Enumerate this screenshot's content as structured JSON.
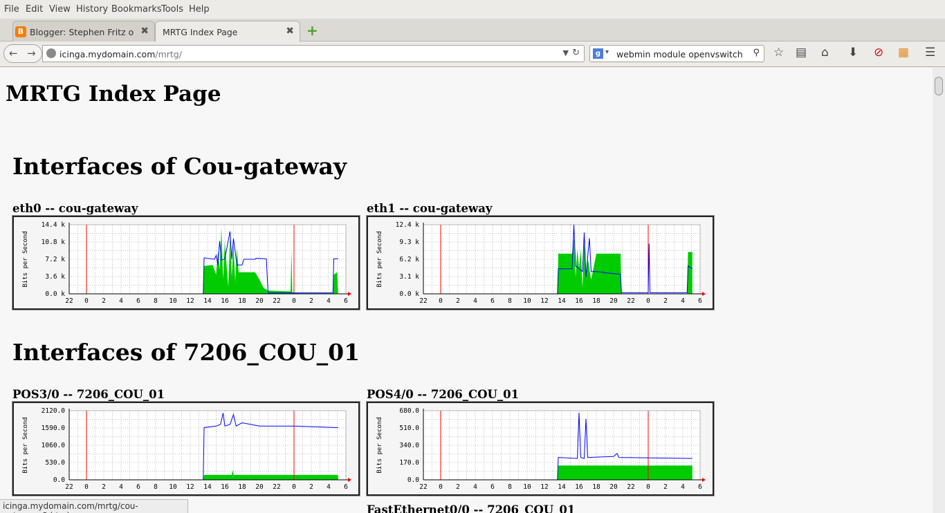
{
  "menu": [
    "File",
    "Edit",
    "View",
    "History",
    "Bookmarks",
    "Tools",
    "Help"
  ],
  "tabs": [
    {
      "title": "Blogger: Stephen Fritz o...",
      "favicon": "B",
      "active": false
    },
    {
      "title": "MRTG Index Page",
      "active": true
    }
  ],
  "tab_close": "✖",
  "new_tab": "+",
  "nav": {
    "back": "←",
    "forward": "→",
    "url_host": "icinga.mydomain.com",
    "url_path": "/mrtg/",
    "search_engine": "g",
    "search_query": "webmin module openvswitch"
  },
  "page": {
    "title": "MRTG Index Page",
    "sections": [
      {
        "heading": "Interfaces of Cou-gateway",
        "graphs": [
          {
            "name": "eth0 -- cou-gateway",
            "ylabel": "Bits per Second",
            "yticks": [
              "14.4 k",
              "10.8 k",
              "7.2 k",
              "3.6 k",
              "0.0 k"
            ],
            "ymax": 14400
          },
          {
            "name": "eth1 -- cou-gateway",
            "ylabel": "Bits per Second",
            "yticks": [
              "12.4 k",
              "9.3 k",
              "6.2 k",
              "3.1 k",
              "0.0 k"
            ],
            "ymax": 12400
          }
        ]
      },
      {
        "heading": "Interfaces of 7206_COU_01",
        "graphs": [
          {
            "name": "POS3/0 -- 7206_COU_01",
            "ylabel": "Bits per Second",
            "yticks": [
              "2120.0",
              "1590.0",
              "1060.0",
              "530.0",
              "0.0"
            ],
            "ymax": 2120
          },
          {
            "name": "POS4/0 -- 7206_COU_01",
            "ylabel": "Bits per Second",
            "yticks": [
              "680.0",
              "510.0",
              "340.0",
              "170.0",
              "0.0"
            ],
            "ymax": 680
          }
        ]
      }
    ],
    "next_graph_name": "FastEthernet0/0 -- 7206_COU_01"
  },
  "xticks": [
    "22",
    "0",
    "2",
    "4",
    "6",
    "8",
    "10",
    "12",
    "14",
    "16",
    "18",
    "20",
    "22",
    "0",
    "2",
    "4",
    "6"
  ],
  "status_url": "icinga.mydomain.com/mrtg/cou-gateway_3.html",
  "colors": {
    "in_traffic": "#00cc00",
    "out_traffic": "#0000ff",
    "day_marker": "#ff0000"
  },
  "chart_data": [
    {
      "type": "area",
      "title": "eth0 -- cou-gateway",
      "ylabel": "Bits per Second",
      "ylim": [
        0,
        14400
      ],
      "x_hours": [
        "22",
        "0",
        "2",
        "4",
        "6",
        "8",
        "10",
        "12",
        "14",
        "16",
        "18",
        "20",
        "22",
        "0",
        "2",
        "4",
        "6"
      ],
      "series": [
        {
          "name": "in",
          "points": [
            [
              13.5,
              0
            ],
            [
              13.6,
              5800
            ],
            [
              14.6,
              6000
            ],
            [
              15,
              4000
            ],
            [
              15.2,
              9000
            ],
            [
              15.4,
              5000
            ],
            [
              15.6,
              13800
            ],
            [
              15.8,
              3000
            ],
            [
              16.0,
              11000
            ],
            [
              16.2,
              6000
            ],
            [
              16.4,
              1500
            ],
            [
              16.6,
              12000
            ],
            [
              16.8,
              3500
            ],
            [
              17.0,
              10500
            ],
            [
              17.2,
              2500
            ],
            [
              17.4,
              9500
            ],
            [
              17.6,
              4500
            ],
            [
              19.5,
              4500
            ],
            [
              20,
              3000
            ],
            [
              20.5,
              1200
            ],
            [
              21,
              700
            ],
            [
              22,
              600
            ],
            [
              23.6,
              500
            ],
            [
              23.7,
              9000
            ],
            [
              23.8,
              300
            ],
            [
              24.5,
              100
            ],
            [
              28.5,
              100
            ],
            [
              28.6,
              4000
            ],
            [
              29,
              4500
            ],
            [
              29.1,
              0
            ]
          ]
        },
        {
          "name": "out",
          "points": [
            [
              13.5,
              0
            ],
            [
              13.6,
              7500
            ],
            [
              14.8,
              7200
            ],
            [
              15,
              8000
            ],
            [
              15.2,
              6000
            ],
            [
              15.4,
              11000
            ],
            [
              15.6,
              7000
            ],
            [
              16,
              7300
            ],
            [
              16.6,
              13000
            ],
            [
              16.8,
              7200
            ],
            [
              17.0,
              11500
            ],
            [
              17.4,
              6000
            ],
            [
              18,
              6000
            ],
            [
              18.2,
              7200
            ],
            [
              19.5,
              7200
            ],
            [
              19.6,
              7400
            ],
            [
              20.8,
              7300
            ],
            [
              21,
              200
            ],
            [
              24,
              200
            ],
            [
              28.5,
              200
            ],
            [
              28.6,
              7300
            ],
            [
              29.1,
              7300
            ]
          ]
        }
      ]
    },
    {
      "type": "area",
      "title": "eth1 -- cou-gateway",
      "ylabel": "Bits per Second",
      "ylim": [
        0,
        12400
      ],
      "x_hours": [
        "22",
        "0",
        "2",
        "4",
        "6",
        "8",
        "10",
        "12",
        "14",
        "16",
        "18",
        "20",
        "22",
        "0",
        "2",
        "4",
        "6"
      ],
      "series": [
        {
          "name": "in",
          "points": [
            [
              13.5,
              0
            ],
            [
              13.6,
              7200
            ],
            [
              15.2,
              7200
            ],
            [
              15.4,
              10000
            ],
            [
              15.6,
              3000
            ],
            [
              15.8,
              8000
            ],
            [
              16,
              4500
            ],
            [
              16.2,
              8000
            ],
            [
              16.4,
              1000
            ],
            [
              16.6,
              9500
            ],
            [
              16.8,
              3500
            ],
            [
              17,
              6500
            ],
            [
              17.4,
              2500
            ],
            [
              18,
              7200
            ],
            [
              20.8,
              7200
            ],
            [
              20.9,
              0
            ],
            [
              28.5,
              0
            ],
            [
              28.6,
              7500
            ],
            [
              29.1,
              7500
            ]
          ]
        },
        {
          "name": "out",
          "points": [
            [
              13.5,
              0
            ],
            [
              13.6,
              4500
            ],
            [
              15.2,
              4500
            ],
            [
              15.4,
              12400
            ],
            [
              15.6,
              5000
            ],
            [
              16,
              4500
            ],
            [
              16.4,
              4000
            ],
            [
              16.6,
              11000
            ],
            [
              16.8,
              3000
            ],
            [
              17.2,
              10000
            ],
            [
              17.4,
              4000
            ],
            [
              18,
              4000
            ],
            [
              19,
              3800
            ],
            [
              20.8,
              3500
            ],
            [
              20.9,
              200
            ],
            [
              24,
              200
            ],
            [
              24.1,
              9000
            ],
            [
              24.2,
              200
            ],
            [
              28.5,
              200
            ],
            [
              28.6,
              5000
            ],
            [
              29.1,
              4500
            ]
          ]
        }
      ]
    },
    {
      "type": "area",
      "title": "POS3/0 -- 7206_COU_01",
      "ylabel": "Bits per Second",
      "ylim": [
        0,
        2120
      ],
      "x_hours": [
        "22",
        "0",
        "2",
        "4",
        "6",
        "8",
        "10",
        "12",
        "14",
        "16",
        "18",
        "20",
        "22",
        "0",
        "2",
        "4",
        "6"
      ],
      "series": [
        {
          "name": "in",
          "points": [
            [
              13.5,
              0
            ],
            [
              13.6,
              150
            ],
            [
              16.8,
              150
            ],
            [
              16.9,
              300
            ],
            [
              17.0,
              150
            ],
            [
              29.1,
              150
            ]
          ]
        },
        {
          "name": "out",
          "points": [
            [
              13.5,
              0
            ],
            [
              13.6,
              1600
            ],
            [
              15,
              1650
            ],
            [
              15.5,
              1700
            ],
            [
              15.8,
              2050
            ],
            [
              16,
              1650
            ],
            [
              16.6,
              1700
            ],
            [
              17,
              2000
            ],
            [
              17.3,
              1650
            ],
            [
              18,
              1750
            ],
            [
              20,
              1650
            ],
            [
              24,
              1650
            ],
            [
              29.1,
              1600
            ]
          ]
        }
      ]
    },
    {
      "type": "area",
      "title": "POS4/0 -- 7206_COU_01",
      "ylabel": "Bits per Second",
      "ylim": [
        0,
        680
      ],
      "x_hours": [
        "22",
        "0",
        "2",
        "4",
        "6",
        "8",
        "10",
        "12",
        "14",
        "16",
        "18",
        "20",
        "22",
        "0",
        "2",
        "4",
        "6"
      ],
      "series": [
        {
          "name": "in",
          "points": [
            [
              13.5,
              0
            ],
            [
              13.6,
              140
            ],
            [
              29.1,
              140
            ]
          ]
        },
        {
          "name": "out",
          "points": [
            [
              13.5,
              0
            ],
            [
              13.6,
              220
            ],
            [
              15.8,
              210
            ],
            [
              16,
              660
            ],
            [
              16.2,
              220
            ],
            [
              16.6,
              210
            ],
            [
              16.8,
              600
            ],
            [
              17,
              220
            ],
            [
              20,
              230
            ],
            [
              20.4,
              260
            ],
            [
              20.6,
              220
            ],
            [
              29.1,
              210
            ]
          ]
        }
      ]
    }
  ]
}
